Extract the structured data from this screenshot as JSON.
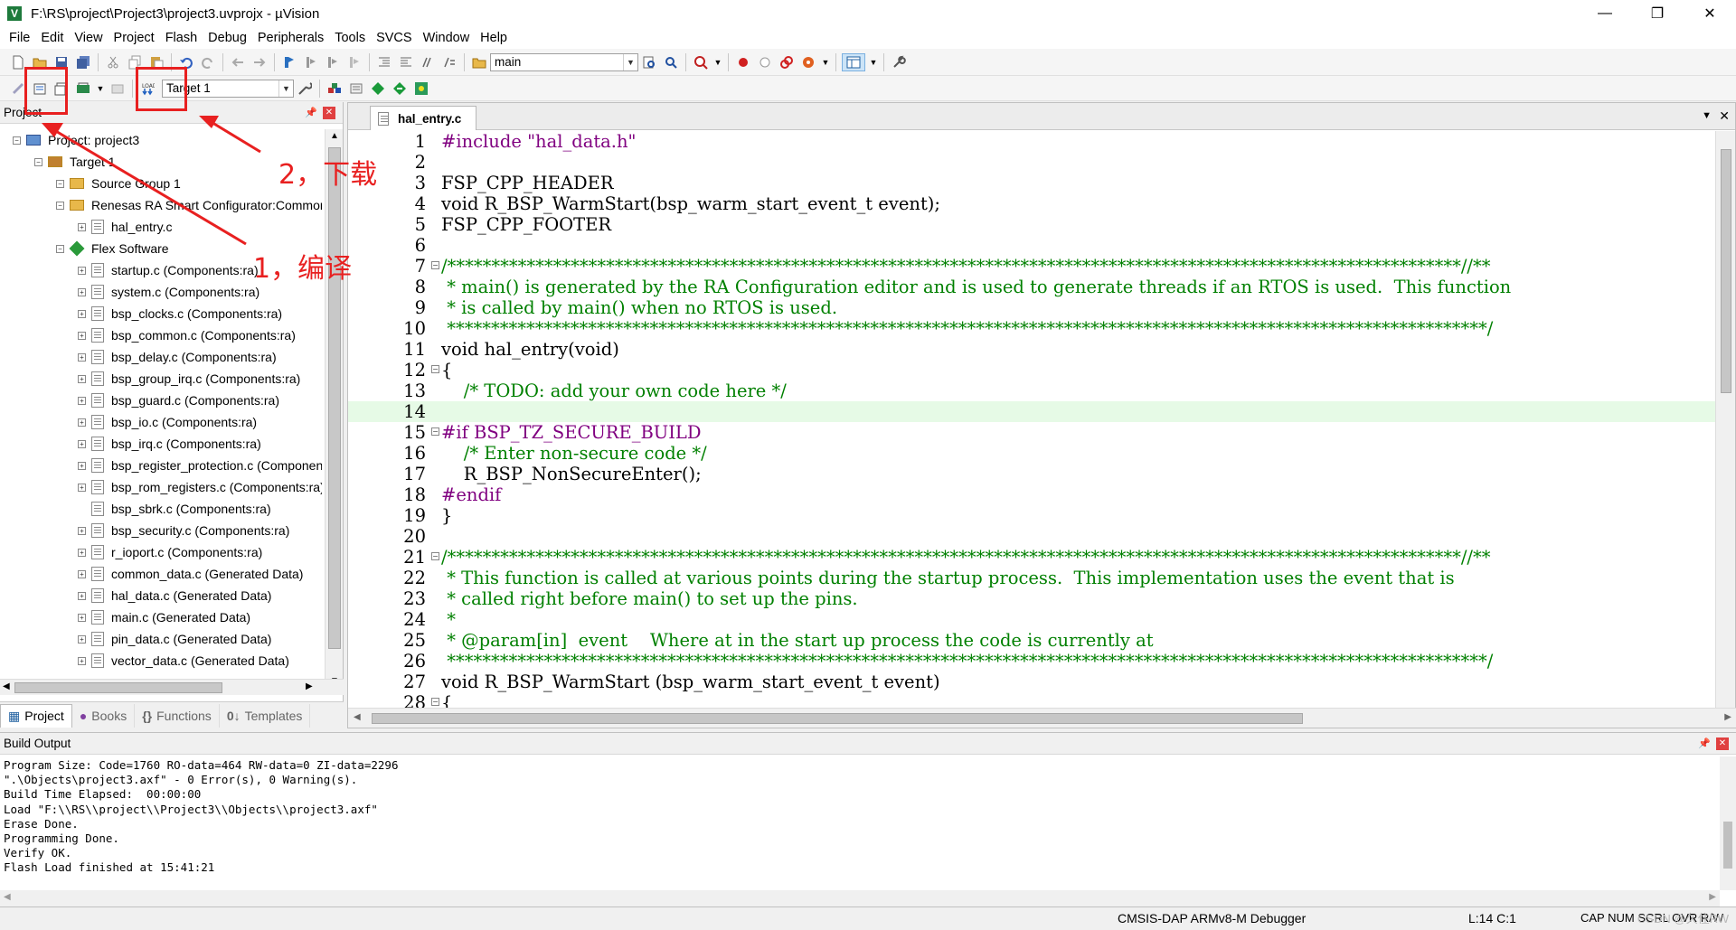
{
  "window": {
    "title": "F:\\RS\\project\\Project3\\project3.uvprojx - µVision",
    "minimize": "—",
    "maximize": "❐",
    "close": "✕"
  },
  "menu": [
    "File",
    "Edit",
    "View",
    "Project",
    "Flash",
    "Debug",
    "Peripherals",
    "Tools",
    "SVCS",
    "Window",
    "Help"
  ],
  "toolbar": {
    "function_combo": "main",
    "target_combo": "Target 1"
  },
  "project_panel": {
    "title": "Project",
    "tree": [
      {
        "label": "Project: project3",
        "level": 0,
        "kind": "project"
      },
      {
        "label": "Target 1",
        "level": 1,
        "kind": "target"
      },
      {
        "label": "Source Group 1",
        "level": 2,
        "kind": "folder"
      },
      {
        "label": "Renesas RA Smart Configurator:Common Sources",
        "level": 2,
        "kind": "folder"
      },
      {
        "label": "hal_entry.c",
        "level": 3,
        "kind": "file"
      },
      {
        "label": "Flex Software",
        "level": 2,
        "kind": "gem"
      },
      {
        "label": "startup.c (Components:ra)",
        "level": 3,
        "kind": "file"
      },
      {
        "label": "system.c (Components:ra)",
        "level": 3,
        "kind": "file"
      },
      {
        "label": "bsp_clocks.c (Components:ra)",
        "level": 3,
        "kind": "file"
      },
      {
        "label": "bsp_common.c (Components:ra)",
        "level": 3,
        "kind": "file"
      },
      {
        "label": "bsp_delay.c (Components:ra)",
        "level": 3,
        "kind": "file"
      },
      {
        "label": "bsp_group_irq.c (Components:ra)",
        "level": 3,
        "kind": "file"
      },
      {
        "label": "bsp_guard.c (Components:ra)",
        "level": 3,
        "kind": "file"
      },
      {
        "label": "bsp_io.c (Components:ra)",
        "level": 3,
        "kind": "file"
      },
      {
        "label": "bsp_irq.c (Components:ra)",
        "level": 3,
        "kind": "file"
      },
      {
        "label": "bsp_register_protection.c (Components:ra)",
        "level": 3,
        "kind": "file"
      },
      {
        "label": "bsp_rom_registers.c (Components:ra)",
        "level": 3,
        "kind": "file"
      },
      {
        "label": "bsp_sbrk.c (Components:ra)",
        "level": 3,
        "kind": "file-noexp"
      },
      {
        "label": "bsp_security.c (Components:ra)",
        "level": 3,
        "kind": "file"
      },
      {
        "label": "r_ioport.c (Components:ra)",
        "level": 3,
        "kind": "file"
      },
      {
        "label": "common_data.c (Generated Data)",
        "level": 3,
        "kind": "file"
      },
      {
        "label": "hal_data.c (Generated Data)",
        "level": 3,
        "kind": "file"
      },
      {
        "label": "main.c (Generated Data)",
        "level": 3,
        "kind": "file"
      },
      {
        "label": "pin_data.c (Generated Data)",
        "level": 3,
        "kind": "file"
      },
      {
        "label": "vector_data.c (Generated Data)",
        "level": 3,
        "kind": "file"
      }
    ],
    "tabs": [
      "Project",
      "Books",
      "Functions",
      "Templates"
    ]
  },
  "editor": {
    "tab": "hal_entry.c",
    "lines": [
      {
        "n": "1",
        "text": "#include \"hal_data.h\"",
        "fold": ""
      },
      {
        "n": "2",
        "text": "",
        "fold": ""
      },
      {
        "n": "3",
        "text": "FSP_CPP_HEADER",
        "fold": ""
      },
      {
        "n": "4",
        "text": "void R_BSP_WarmStart(bsp_warm_start_event_t event);",
        "fold": ""
      },
      {
        "n": "5",
        "text": "FSP_CPP_FOOTER",
        "fold": ""
      },
      {
        "n": "6",
        "text": "",
        "fold": ""
      },
      {
        "n": "7",
        "text": "/*******************************************************************************************************************//**",
        "fold": "−"
      },
      {
        "n": "8",
        "text": " * main() is generated by the RA Configuration editor and is used to generate threads if an RTOS is used.  This function",
        "fold": ""
      },
      {
        "n": "9",
        "text": " * is called by main() when no RTOS is used.",
        "fold": ""
      },
      {
        "n": "10",
        "text": " **********************************************************************************************************************/",
        "fold": ""
      },
      {
        "n": "11",
        "text": "void hal_entry(void)",
        "fold": ""
      },
      {
        "n": "12",
        "text": "{",
        "fold": "−"
      },
      {
        "n": "13",
        "text": "    /* TODO: add your own code here */",
        "fold": ""
      },
      {
        "n": "14",
        "text": "",
        "fold": ""
      },
      {
        "n": "15",
        "text": "#if BSP_TZ_SECURE_BUILD",
        "fold": "−"
      },
      {
        "n": "16",
        "text": "    /* Enter non-secure code */",
        "fold": ""
      },
      {
        "n": "17",
        "text": "    R_BSP_NonSecureEnter();",
        "fold": ""
      },
      {
        "n": "18",
        "text": "#endif",
        "fold": ""
      },
      {
        "n": "19",
        "text": "}",
        "fold": ""
      },
      {
        "n": "20",
        "text": "",
        "fold": ""
      },
      {
        "n": "21",
        "text": "/*******************************************************************************************************************//**",
        "fold": "−"
      },
      {
        "n": "22",
        "text": " * This function is called at various points during the startup process.  This implementation uses the event that is",
        "fold": ""
      },
      {
        "n": "23",
        "text": " * called right before main() to set up the pins.",
        "fold": ""
      },
      {
        "n": "24",
        "text": " *",
        "fold": ""
      },
      {
        "n": "25",
        "text": " * @param[in]  event    Where at in the start up process the code is currently at",
        "fold": ""
      },
      {
        "n": "26",
        "text": " **********************************************************************************************************************/",
        "fold": ""
      },
      {
        "n": "27",
        "text": "void R_BSP_WarmStart (bsp_warm_start_event_t event)",
        "fold": ""
      },
      {
        "n": "28",
        "text": "{",
        "fold": "−"
      }
    ]
  },
  "build_output": {
    "title": "Build Output",
    "lines": [
      "Program Size: Code=1760 RO-data=464 RW-data=0 ZI-data=2296",
      "\".\\Objects\\project3.axf\" - 0 Error(s), 0 Warning(s).",
      "Build Time Elapsed:  00:00:00",
      "Load \"F:\\\\RS\\\\project\\\\Project3\\\\Objects\\\\project3.axf\"",
      "Erase Done.",
      "Programming Done.",
      "Verify OK.",
      "Flash Load finished at 15:41:21"
    ]
  },
  "status": {
    "debugger": "CMSIS-DAP ARMv8-M Debugger",
    "position": "L:14 C:1",
    "indicators": "CAP  NUM  SCRL  OVR  R/W"
  },
  "annotations": {
    "download": "2，下载",
    "compile": "1，编译",
    "color": "#e82020"
  },
  "watermark": "CSDN @久住RW"
}
